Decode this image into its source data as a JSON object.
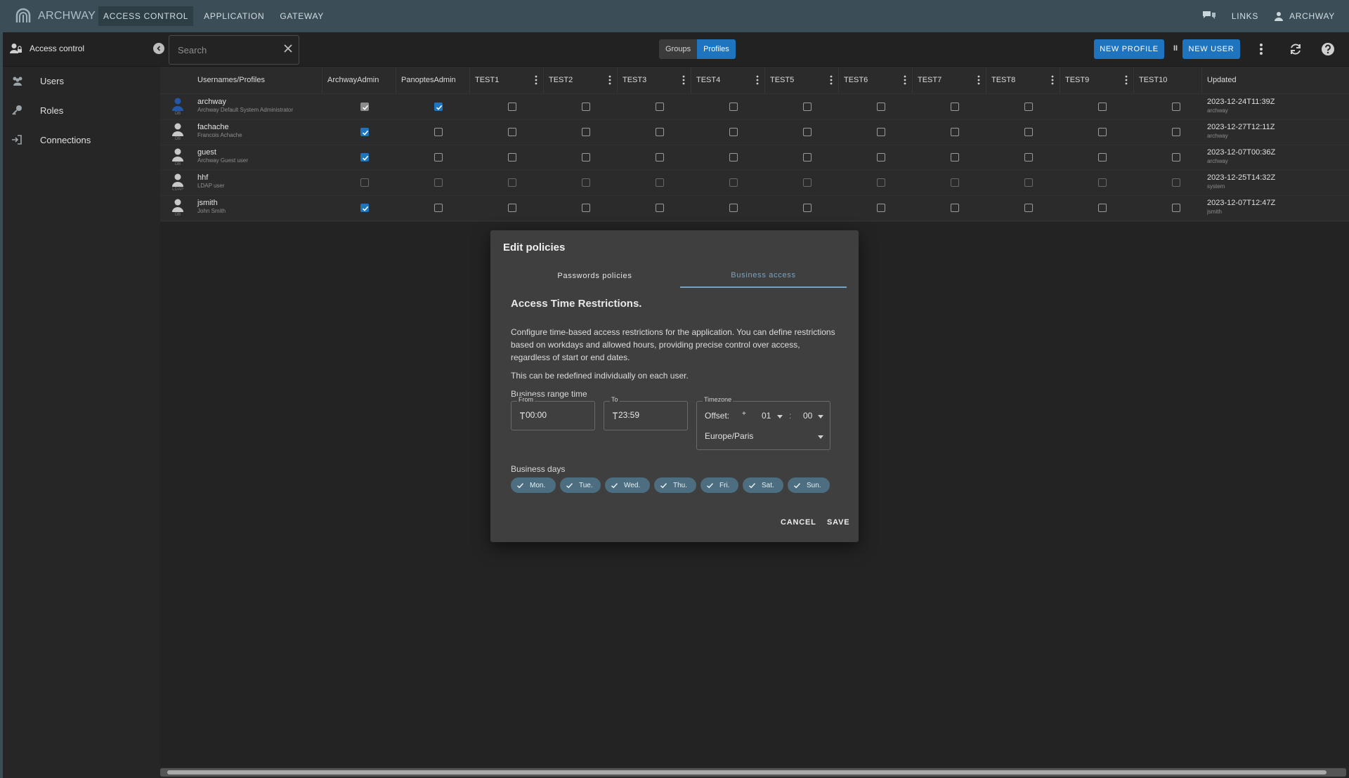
{
  "app": {
    "name": "ARCHWAY"
  },
  "topnav": [
    {
      "label": "ACCESS CONTROL",
      "active": true
    },
    {
      "label": "APPLICATION",
      "active": false
    },
    {
      "label": "GATEWAY",
      "active": false
    }
  ],
  "topright": {
    "links_label": "LINKS",
    "user_label": "ARCHWAY"
  },
  "subbar": {
    "title": "Access control",
    "search_placeholder": "Search",
    "toggle_groups": "Groups",
    "toggle_profiles": "Profiles",
    "new_profile": "NEW PROFILE",
    "sep": "II",
    "new_user": "NEW USER"
  },
  "sidebar": [
    {
      "label": "Users",
      "icon": "users-icon"
    },
    {
      "label": "Roles",
      "icon": "key-icon"
    },
    {
      "label": "Connections",
      "icon": "login-icon"
    }
  ],
  "table": {
    "headers": {
      "user": "Usernames/Profiles",
      "profiles": [
        "ArchwayAdmin",
        "PanoptesAdmin",
        "TEST1",
        "TEST2",
        "TEST3",
        "TEST4",
        "TEST5",
        "TEST6",
        "TEST7",
        "TEST8",
        "TEST9",
        "TEST10"
      ],
      "updated": "Updated"
    },
    "rows": [
      {
        "name": "archway",
        "desc": "Archway Default System Administrator",
        "src": "DB",
        "updated": "2023-12-24T11:39Z",
        "by": "archway",
        "checks": [
          "grey",
          "on"
        ]
      },
      {
        "name": "fachache",
        "desc": "Francois Achache",
        "src": "DB",
        "updated": "2023-12-27T12:11Z",
        "by": "archway",
        "checks": [
          "on",
          "off"
        ]
      },
      {
        "name": "guest",
        "desc": "Archway Guest user",
        "src": "DB",
        "updated": "2023-12-07T00:36Z",
        "by": "archway",
        "checks": [
          "on",
          "off"
        ]
      },
      {
        "name": "hhf",
        "desc": "LDAP user",
        "src": "LDAP",
        "updated": "2023-12-25T14:32Z",
        "by": "system",
        "checks": [
          "off",
          "off"
        ]
      },
      {
        "name": "jsmith",
        "desc": "John Smith",
        "src": "DB",
        "updated": "2023-12-07T12:47Z",
        "by": "jsmith",
        "checks": [
          "on",
          "off"
        ]
      }
    ]
  },
  "dialog": {
    "title": "Edit policies",
    "tabs": [
      "Passwords policies",
      "Business access"
    ],
    "active_tab": 1,
    "heading": "Access Time Restrictions.",
    "description": "Configure time-based access restrictions for the application. You can define restrictions based on workdays and allowed hours, providing precise control over access, regardless of start or end dates.",
    "note": "This can be redefined individually on each user.",
    "range_label": "Business range time",
    "from_label": "From",
    "from_value": "00:00",
    "to_label": "To",
    "to_value": "23:59",
    "timezone_label": "Timezone",
    "offset_label": "Offset:",
    "offset_sign": "+",
    "offset_hours": "01",
    "offset_colon": ":",
    "offset_minutes": "00",
    "timezone_value": "Europe/Paris",
    "days_label": "Business days",
    "days": [
      "Mon.",
      "Tue.",
      "Wed.",
      "Thu.",
      "Fri.",
      "Sat.",
      "Sun."
    ],
    "cancel": "CANCEL",
    "save": "SAVE"
  },
  "colors": {
    "accent": "#1e74bf",
    "topbar": "#3b4e57",
    "chip": "#4d6e80"
  }
}
